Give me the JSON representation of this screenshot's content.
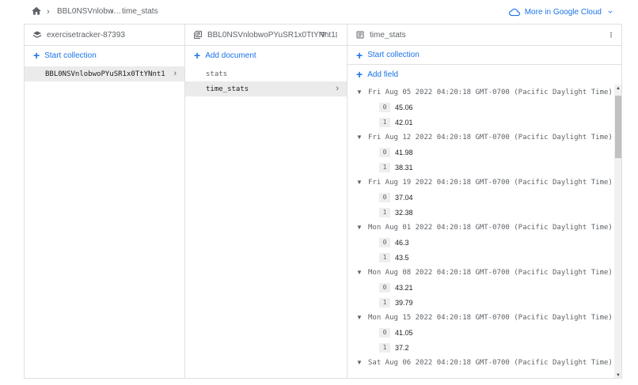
{
  "breadcrumb": {
    "doc": "BBL0NSVnlobw…",
    "collection": "time_stats"
  },
  "cloud_link": "More in Google Cloud",
  "panels": {
    "root": {
      "title": "exercisetracker-87393",
      "action": "Start collection",
      "items": [
        "BBL0NSVnlobwoPYuSR1x0TtYNnt1"
      ]
    },
    "collection": {
      "title": "BBL0NSVnlobwoPYuSR1x0TtYNnt1",
      "action": "Add document",
      "items": [
        "stats",
        "time_stats"
      ]
    },
    "document": {
      "title": "time_stats",
      "action_collection": "Start collection",
      "action_field": "Add field"
    }
  },
  "fields": [
    {
      "key": "Fri Aug 05 2022 04:20:18 GMT-0700 (Pacific Daylight Time)",
      "values": [
        [
          "0",
          "45.06"
        ],
        [
          "1",
          "42.01"
        ]
      ]
    },
    {
      "key": "Fri Aug 12 2022 04:20:18 GMT-0700 (Pacific Daylight Time)",
      "values": [
        [
          "0",
          "41.98"
        ],
        [
          "1",
          "38.31"
        ]
      ]
    },
    {
      "key": "Fri Aug 19 2022 04:20:18 GMT-0700 (Pacific Daylight Time)",
      "values": [
        [
          "0",
          "37.04"
        ],
        [
          "1",
          "32.38"
        ]
      ]
    },
    {
      "key": "Mon Aug 01 2022 04:20:18 GMT-0700 (Pacific Daylight Time)",
      "values": [
        [
          "0",
          "46.3"
        ],
        [
          "1",
          "43.5"
        ]
      ]
    },
    {
      "key": "Mon Aug 08 2022 04:20:18 GMT-0700 (Pacific Daylight Time)",
      "values": [
        [
          "0",
          "43.21"
        ],
        [
          "1",
          "39.79"
        ]
      ]
    },
    {
      "key": "Mon Aug 15 2022 04:20:18 GMT-0700 (Pacific Daylight Time)",
      "values": [
        [
          "0",
          "41.05"
        ],
        [
          "1",
          "37.2"
        ]
      ]
    },
    {
      "key": "Sat Aug 06 2022 04:20:18 GMT-0700 (Pacific Daylight Time)",
      "values": []
    }
  ],
  "colors": {
    "accent": "#1a73e8",
    "selected_row": "#ebebeb",
    "border": "#e0e0e0"
  }
}
